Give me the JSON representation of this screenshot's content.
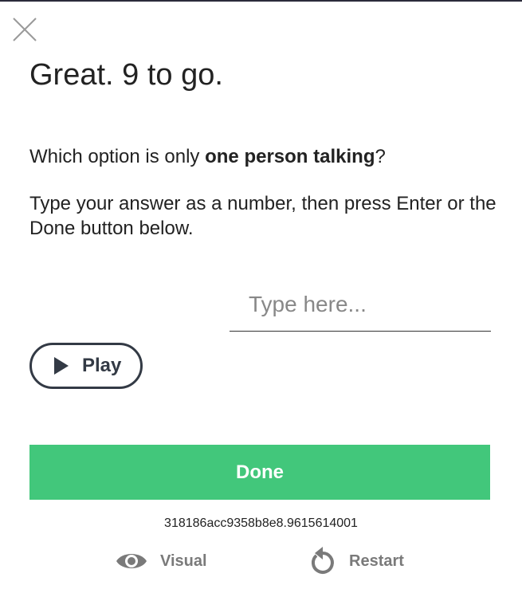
{
  "header": {
    "close_icon": "close-icon",
    "title": "Great. 9 to go."
  },
  "prompt": {
    "question_prefix": "Which option is only ",
    "question_bold": "one person talking",
    "question_suffix": "?",
    "instruction": "Type your answer as a number, then press Enter or the Done button below."
  },
  "answer": {
    "placeholder": "Type here...",
    "value": ""
  },
  "play": {
    "icon": "play-icon",
    "label": "Play"
  },
  "done": {
    "label": "Done"
  },
  "session": {
    "id": "318186acc9358b8e8.9615614001"
  },
  "footer": {
    "visual": {
      "icon": "eye-icon",
      "label": "Visual"
    },
    "restart": {
      "icon": "restart-icon",
      "label": "Restart"
    }
  },
  "colors": {
    "accent": "#42c77b",
    "text": "#222222",
    "muted": "#7a7a7a",
    "outline": "#333a45"
  }
}
